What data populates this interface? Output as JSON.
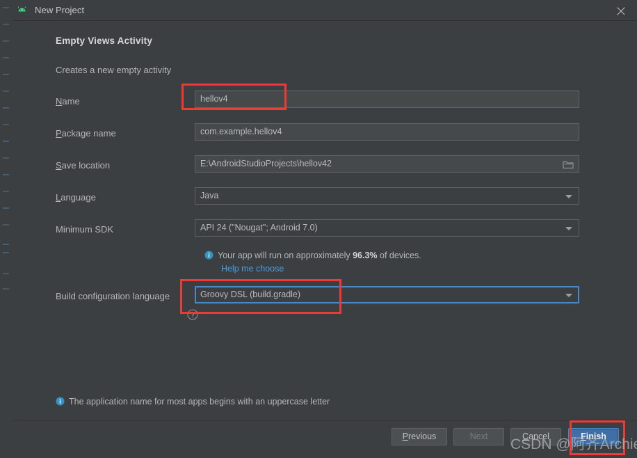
{
  "window": {
    "title": "New Project",
    "app_icon": "android-robot-icon",
    "close_icon": "close-icon"
  },
  "template": {
    "title": "Empty Views Activity",
    "description": "Creates a new empty activity"
  },
  "form": {
    "name": {
      "label_prefix": "",
      "label_mnemonic": "N",
      "label_suffix": "ame",
      "value": "hellov4"
    },
    "package_name": {
      "label_prefix": "",
      "label_mnemonic": "P",
      "label_suffix": "ackage name",
      "value": "com.example.hellov4"
    },
    "save_location": {
      "label_prefix": "",
      "label_mnemonic": "S",
      "label_suffix": "ave location",
      "value": "E:\\AndroidStudioProjects\\hellov42",
      "browse_icon": "folder-icon"
    },
    "language": {
      "label_prefix": "",
      "label_mnemonic": "L",
      "label_suffix": "anguage",
      "value": "Java",
      "arrow_icon": "chevron-down-icon"
    },
    "minimum_sdk": {
      "label": "Minimum SDK",
      "value": "API 24 (\"Nougat\"; Android 7.0)",
      "arrow_icon": "chevron-down-icon"
    },
    "sdk_info": {
      "icon": "info-icon",
      "text_before": "Your app will run on approximately ",
      "percent": "96.3%",
      "text_after": " of devices.",
      "help_link": "Help me choose"
    },
    "build_configuration_language": {
      "label": "Build configuration language",
      "help_icon": "question-circle-icon",
      "value": "Groovy DSL (build.gradle)",
      "arrow_icon": "chevron-down-icon"
    }
  },
  "bottom_hint": {
    "icon": "info-icon",
    "text": "The application name for most apps begins with an uppercase letter"
  },
  "footer": {
    "previous": {
      "prefix": "",
      "mnemonic": "P",
      "suffix": "revious"
    },
    "next": {
      "label": "Next",
      "disabled": true
    },
    "cancel": {
      "prefix": "",
      "mnemonic": "C",
      "suffix": "ancel"
    },
    "finish": {
      "prefix": "",
      "mnemonic": "F",
      "suffix": "inish"
    }
  },
  "watermark": {
    "text": "CSDN @阿齐Archie"
  },
  "annotations": {
    "accent_color": "#f03a33",
    "targets": [
      "name-field",
      "build-configuration-language-field",
      "finish-button"
    ]
  }
}
